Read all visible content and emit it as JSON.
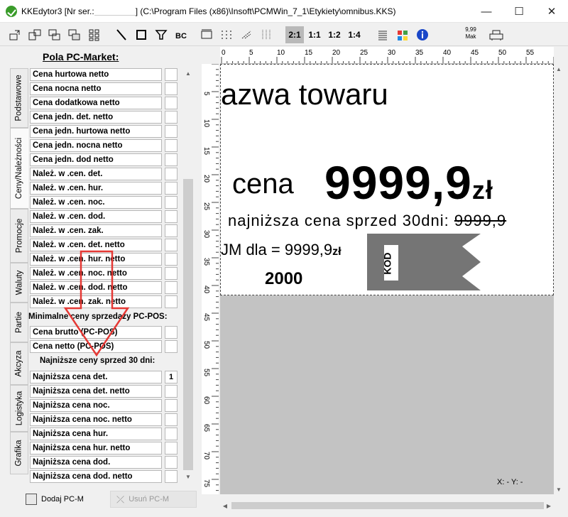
{
  "window": {
    "title_prefix": "KKEdytor3 [Nr ser.:",
    "title_suffix": "] (C:\\Program Files (x86)\\Insoft\\PCMWin_7_1\\Etykiety\\omnibus.KKS)",
    "minimize": "—",
    "maximize": "☐",
    "close": "✕"
  },
  "toolbar": {
    "zoom_21": "2:1",
    "zoom_11": "1:1",
    "zoom_12": "1:2",
    "zoom_14": "1:4",
    "mak_price": "9,99",
    "mak_label": "Mak"
  },
  "left_panel": {
    "title": "Pola PC-Market:",
    "tabs": [
      "Podstawowe",
      "Ceny/Należności",
      "Promocje",
      "Waluty",
      "Partie",
      "Akcyza",
      "Logistyka",
      "Grafika"
    ],
    "fields_group1": [
      "Cena hurtowa netto",
      "Cena nocna netto",
      "Cena dodatkowa netto",
      "Cena jedn. det. netto",
      "Cena jedn. hurtowa netto",
      "Cena jedn. nocna netto",
      "Cena jedn. dod netto",
      "Należ. w .cen. det.",
      "Należ. w .cen. hur.",
      "Należ. w .cen. noc.",
      "Należ. w .cen. dod.",
      "Należ. w .cen. zak.",
      "Należ. w .cen. det. netto",
      "Należ. w .cen. hur. netto",
      "Należ. w .cen. noc. netto",
      "Należ. w .cen. dod. netto",
      "Należ. w .cen. zak. netto"
    ],
    "section_min": "Minimalne ceny sprzedaży PC-POS:",
    "fields_group2": [
      "Cena brutto (PC-POS)",
      "Cena netto  (PC-POS)"
    ],
    "section_30": "Najniższe ceny sprzed 30 dni:",
    "fields_group3": [
      "Najniższa cena det.",
      "Najniższa cena det. netto",
      "Najniższa cena noc.",
      "Najniższa cena noc. netto",
      "Najniższa cena hur.",
      "Najniższa cena hur. netto",
      "Najniższa cena dod.",
      "Najniższa cena dod. netto"
    ],
    "first_value": "1",
    "add_button": "Dodaj PC-M",
    "remove_button": "Usuń PC-M"
  },
  "label": {
    "name_text": "azwa towaru",
    "cena_word": "cena",
    "price": "9999,9",
    "currency": "zł",
    "lowest_text": "najniższa cena sprzed 30dni:",
    "lowest_value": "9999,9",
    "jm_text": "JM dla = 9999,9",
    "jm_currency": "zł",
    "number": "2000",
    "barcode_text": "KOD"
  },
  "ruler": {
    "top": [
      "0",
      "5",
      "10",
      "15",
      "20",
      "25",
      "30",
      "35",
      "40",
      "45",
      "50",
      "55"
    ],
    "left": [
      "5",
      "10",
      "15",
      "20",
      "25",
      "30",
      "35",
      "40",
      "45",
      "50",
      "55",
      "60",
      "65",
      "70",
      "75"
    ]
  },
  "status": {
    "coords": "X: - Y: -"
  },
  "colors": {
    "arrow": "#e53935",
    "barcode": "#757575",
    "active_zoom": "#b9b9b9",
    "gray_area": "#c3c3c3"
  }
}
